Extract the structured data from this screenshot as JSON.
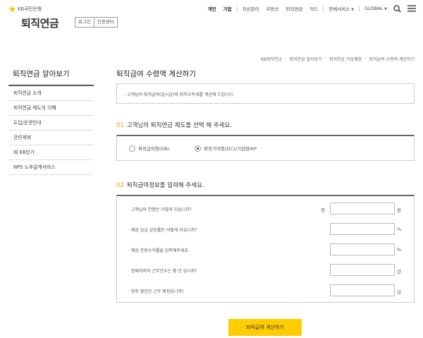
{
  "header": {
    "logo_text": "KB국민은행",
    "site_title": "퇴직연금",
    "login_label": "로그인",
    "cert_label": "인증센터",
    "gnb": {
      "personal": "개인",
      "corporate": "기업",
      "asset": "자산관리",
      "realestate": "부동산",
      "pension": "퇴직연금",
      "card": "카드",
      "all_services": "전체서비스",
      "global": "GLOBAL"
    }
  },
  "breadcrumb": [
    "KB퇴직연금",
    "퇴직연금 알아보기",
    "퇴직연금 가상체험",
    "퇴직급여 수령액 계산하기"
  ],
  "sidebar": {
    "title": "퇴직연금 알아보기",
    "items": [
      {
        "label": "퇴직연금 소개"
      },
      {
        "label": "퇴직연금 제도의 이해"
      },
      {
        "label": "도입/운영안내"
      },
      {
        "label": "관련세제"
      },
      {
        "label": "왜 KB인가"
      },
      {
        "label": "NPS 노후설계서비스"
      }
    ]
  },
  "main": {
    "title": "퇴직급여 수령액 계산하기",
    "notice": "- 고객님의 퇴직급여(일시금)와 퇴직소득세를 계산해 드립니다.",
    "section1": {
      "num": "01",
      "title": "고객님의 퇴직연금 제도를 선택 해 주세요.",
      "options": [
        {
          "label": "확정급여형(DB)",
          "selected": false
        },
        {
          "label": "확정기여형(DC)/기업형IRP",
          "selected": true
        }
      ]
    },
    "section2": {
      "num": "02",
      "title": "퇴직급여정보를 입력해 주세요.",
      "rows": [
        {
          "question": "· 고객님의 연봉은 어떻게 되십니까?",
          "prefix": "연",
          "value": "",
          "unit": "원"
        },
        {
          "question": "· 예상 임금 상승률은 어떻게 되십니까?",
          "prefix": "",
          "value": "",
          "unit": "%"
        },
        {
          "question": "· 예상 운용수익률을 입력해주세요.",
          "prefix": "",
          "value": "",
          "unit": "%"
        },
        {
          "question": "· 현재까지의 근무년수는 몇 년 입니까?",
          "prefix": "",
          "value": "",
          "unit": "년"
        },
        {
          "question": "· 향후 몇년간 근무 예정입니까?",
          "prefix": "",
          "value": "",
          "unit": "년"
        }
      ]
    },
    "calc_button": "퇴직급여 계산하기"
  },
  "colors": {
    "accent": "#ffcc00",
    "section_number": "#e6a700"
  }
}
